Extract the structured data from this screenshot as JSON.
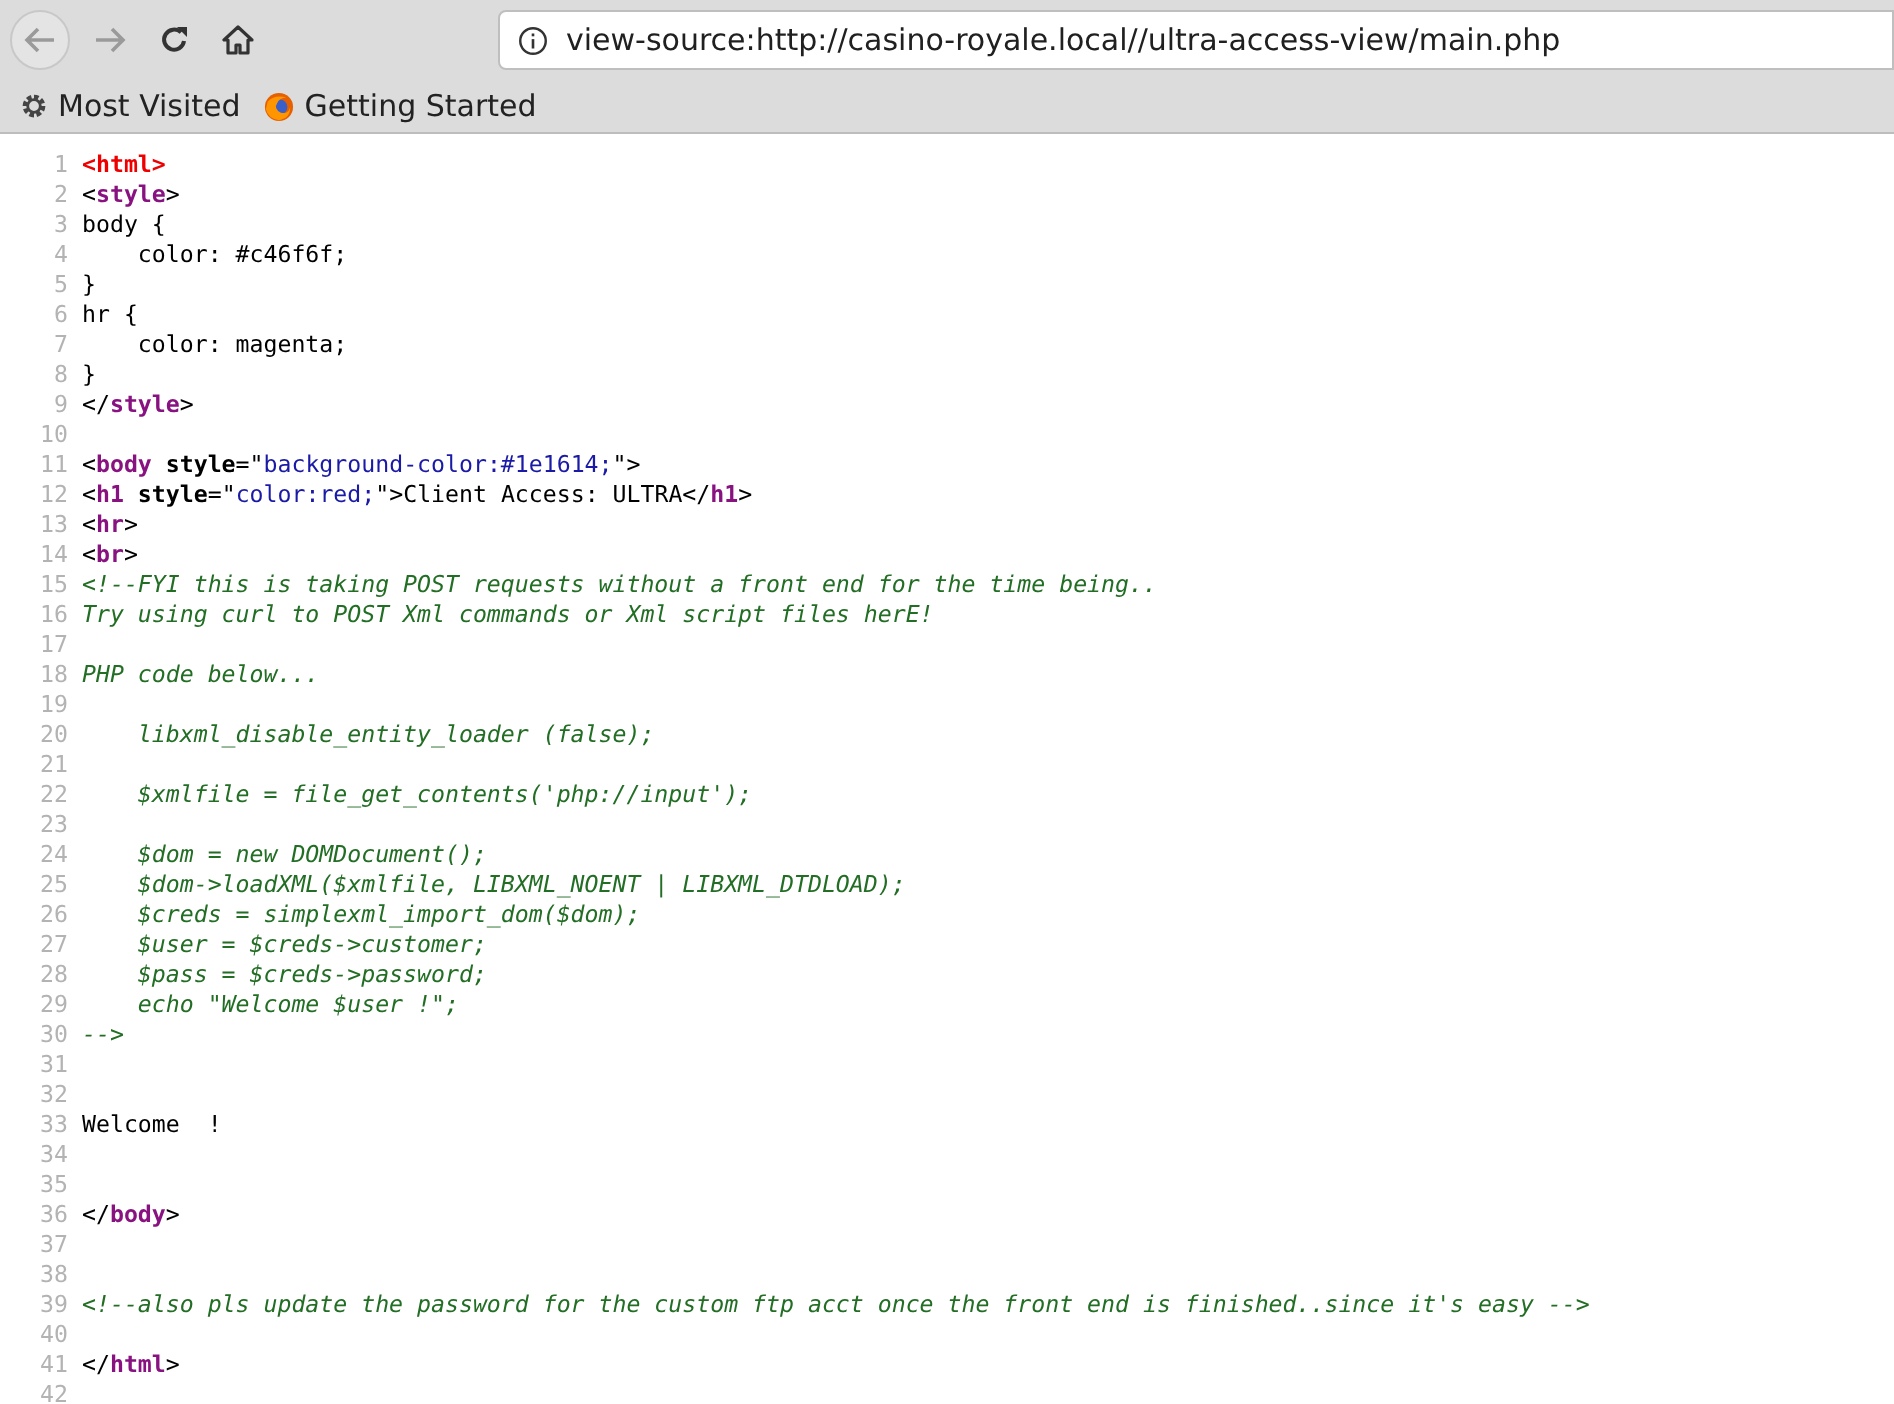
{
  "toolbar": {
    "url": "view-source:http://casino-royale.local//ultra-access-view/main.php"
  },
  "bookmarks": [
    {
      "label": "Most Visited",
      "kind": "gear"
    },
    {
      "label": "Getting Started",
      "kind": "browser"
    }
  ],
  "source_lines": [
    {
      "n": "1",
      "parts": [
        {
          "kind": "error",
          "t": "<html>"
        }
      ]
    },
    {
      "n": "2",
      "parts": [
        {
          "kind": "text",
          "t": "<"
        },
        {
          "kind": "tag",
          "t": "style"
        },
        {
          "kind": "text",
          "t": ">"
        }
      ]
    },
    {
      "n": "3",
      "parts": [
        {
          "kind": "text",
          "t": "body {"
        }
      ]
    },
    {
      "n": "4",
      "parts": [
        {
          "kind": "text",
          "t": "    color: #c46f6f;"
        }
      ]
    },
    {
      "n": "5",
      "parts": [
        {
          "kind": "text",
          "t": "}"
        }
      ]
    },
    {
      "n": "6",
      "parts": [
        {
          "kind": "text",
          "t": "hr {"
        }
      ]
    },
    {
      "n": "7",
      "parts": [
        {
          "kind": "text",
          "t": "    color: magenta;"
        }
      ]
    },
    {
      "n": "8",
      "parts": [
        {
          "kind": "text",
          "t": "}"
        }
      ]
    },
    {
      "n": "9",
      "parts": [
        {
          "kind": "text",
          "t": "</"
        },
        {
          "kind": "tag",
          "t": "style"
        },
        {
          "kind": "text",
          "t": ">"
        }
      ]
    },
    {
      "n": "10"
    },
    {
      "n": "11",
      "parts": [
        {
          "kind": "text",
          "t": "<"
        },
        {
          "kind": "tag",
          "t": "body"
        },
        {
          "kind": "attr",
          "t": " style"
        },
        {
          "kind": "text",
          "t": "=\""
        },
        {
          "kind": "value",
          "t": "background-color:#1e1614;"
        },
        {
          "kind": "text",
          "t": "\">"
        }
      ]
    },
    {
      "n": "12",
      "parts": [
        {
          "kind": "text",
          "t": "<"
        },
        {
          "kind": "tag",
          "t": "h1"
        },
        {
          "kind": "attr",
          "t": " style"
        },
        {
          "kind": "text",
          "t": "=\""
        },
        {
          "kind": "value",
          "t": "color:red;"
        },
        {
          "kind": "text",
          "t": "\">Client Access: ULTRA</"
        },
        {
          "kind": "tag",
          "t": "h1"
        },
        {
          "kind": "text",
          "t": ">"
        }
      ]
    },
    {
      "n": "13",
      "parts": [
        {
          "kind": "text",
          "t": "<"
        },
        {
          "kind": "tag",
          "t": "hr"
        },
        {
          "kind": "text",
          "t": ">"
        }
      ]
    },
    {
      "n": "14",
      "parts": [
        {
          "kind": "text",
          "t": "<"
        },
        {
          "kind": "tag",
          "t": "br"
        },
        {
          "kind": "text",
          "t": ">"
        }
      ]
    },
    {
      "n": "15",
      "parts": [
        {
          "kind": "comment",
          "t": "<!--FYI this is taking POST requests without a front end for the time being.."
        }
      ]
    },
    {
      "n": "16",
      "parts": [
        {
          "kind": "comment",
          "t": "Try using curl to POST Xml commands or Xml script files herE!"
        }
      ]
    },
    {
      "n": "17"
    },
    {
      "n": "18",
      "parts": [
        {
          "kind": "comment",
          "t": "PHP code below..."
        }
      ]
    },
    {
      "n": "19"
    },
    {
      "n": "20",
      "parts": [
        {
          "kind": "comment",
          "t": "    libxml_disable_entity_loader (false);"
        }
      ]
    },
    {
      "n": "21"
    },
    {
      "n": "22",
      "parts": [
        {
          "kind": "comment",
          "t": "    $xmlfile = file_get_contents('php://input');"
        }
      ]
    },
    {
      "n": "23"
    },
    {
      "n": "24",
      "parts": [
        {
          "kind": "comment",
          "t": "    $dom = new DOMDocument();"
        }
      ]
    },
    {
      "n": "25",
      "parts": [
        {
          "kind": "comment",
          "t": "    $dom->loadXML($xmlfile, LIBXML_NOENT | LIBXML_DTDLOAD);"
        }
      ]
    },
    {
      "n": "26",
      "parts": [
        {
          "kind": "comment",
          "t": "    $creds = simplexml_import_dom($dom);"
        }
      ]
    },
    {
      "n": "27",
      "parts": [
        {
          "kind": "comment",
          "t": "    $user = $creds->customer;"
        }
      ]
    },
    {
      "n": "28",
      "parts": [
        {
          "kind": "comment",
          "t": "    $pass = $creds->password;"
        }
      ]
    },
    {
      "n": "29",
      "parts": [
        {
          "kind": "comment",
          "t": "    echo \"Welcome $user !\";"
        }
      ]
    },
    {
      "n": "30",
      "parts": [
        {
          "kind": "comment",
          "t": "-->"
        }
      ]
    },
    {
      "n": "31"
    },
    {
      "n": "32"
    },
    {
      "n": "33",
      "parts": [
        {
          "kind": "text",
          "t": "Welcome  !"
        }
      ]
    },
    {
      "n": "34"
    },
    {
      "n": "35"
    },
    {
      "n": "36",
      "parts": [
        {
          "kind": "text",
          "t": "</"
        },
        {
          "kind": "tag",
          "t": "body"
        },
        {
          "kind": "text",
          "t": ">"
        }
      ]
    },
    {
      "n": "37"
    },
    {
      "n": "38"
    },
    {
      "n": "39",
      "parts": [
        {
          "kind": "comment",
          "t": "<!--also pls update the password for the custom ftp acct once the front end is finished..since it's easy -->"
        }
      ]
    },
    {
      "n": "40"
    },
    {
      "n": "41",
      "parts": [
        {
          "kind": "text",
          "t": "</"
        },
        {
          "kind": "tag",
          "t": "html"
        },
        {
          "kind": "text",
          "t": ">"
        }
      ]
    },
    {
      "n": "42"
    }
  ]
}
